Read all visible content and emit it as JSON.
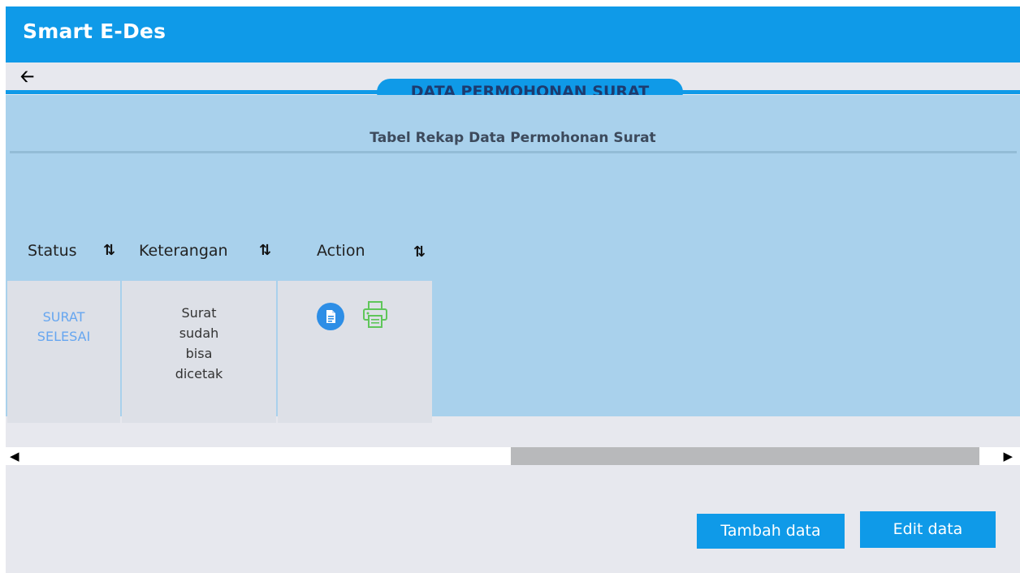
{
  "app": {
    "title": "Smart E-Des"
  },
  "page": {
    "title": "DATA PERMOHONAN SURAT",
    "subtitle": "Tabel Rekap Data Permohonan Surat"
  },
  "table": {
    "columns": [
      {
        "label": "Status",
        "sort_icon": "sort-updown-icon"
      },
      {
        "label": "Keterangan",
        "sort_icon": "sort-updown-icon"
      },
      {
        "label": "Action",
        "sort_icon": "sort-updown-icon"
      }
    ],
    "rows": [
      {
        "status": "SURAT\nSELESAI",
        "keterangan": "Surat\nsudah\nbisa\ndicetak",
        "actions": [
          "document-icon",
          "printer-icon"
        ]
      }
    ]
  },
  "buttons": {
    "add_label": "Tambah data",
    "edit_label": "Edit data"
  },
  "colors": {
    "primary": "#0f9ae8",
    "panel": "#a9d1ec",
    "status_text": "#66a6f0",
    "print_icon": "#5fc65a"
  }
}
